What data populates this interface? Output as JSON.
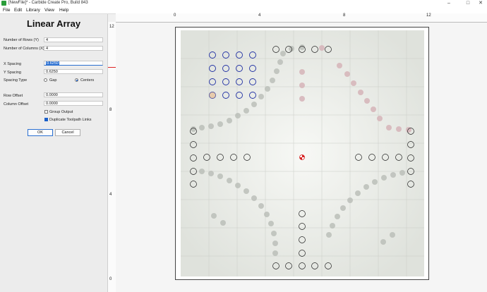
{
  "window": {
    "title": "[NewFile]* - Carbide Create Pro, Build 843"
  },
  "menu": [
    {
      "id": "file",
      "label": "File"
    },
    {
      "id": "edit",
      "label": "Edit"
    },
    {
      "id": "library",
      "label": "Library"
    },
    {
      "id": "view",
      "label": "View"
    },
    {
      "id": "help",
      "label": "Help"
    }
  ],
  "panel": {
    "title": "Linear Array",
    "rows_label": "Number of Rows (Y)",
    "rows_value": "4",
    "cols_label": "Number of Columns (X)",
    "cols_value": "4",
    "xspacing_label": "X Spacing",
    "xspacing_value": "0.6250",
    "yspacing_label": "Y Spacing",
    "yspacing_value": "0.6250",
    "spacingtype_label": "Spacing Type",
    "gap_label": "Gap",
    "centers_label": "Centers",
    "spacing_selected": "Centers",
    "rowoffset_label": "Row Offset",
    "rowoffset_value": "0.0000",
    "coloffset_label": "Column Offset",
    "coloffset_value": "0.0000",
    "group_label": "Group Output",
    "group_checked": false,
    "dup_label": "Duplicate Toolpath Links",
    "dup_checked": true,
    "ok_label": "OK",
    "cancel_label": "Cancel"
  },
  "rulers": {
    "h_ticks": [
      "0",
      "4",
      "8",
      "12"
    ],
    "v_ticks": [
      "12",
      "8",
      "4",
      "0"
    ]
  },
  "colors": {
    "accent": "#2a6fd1",
    "selection": "#1f2fa3",
    "origin": "#d62020"
  }
}
